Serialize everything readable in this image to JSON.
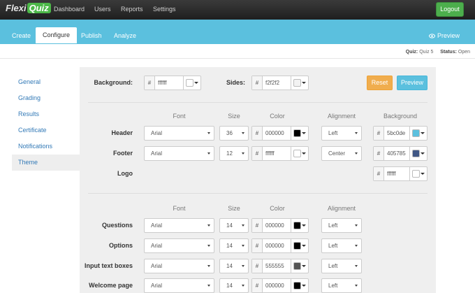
{
  "app": {
    "logo_text": "Flexi",
    "logo_badge": "Quiz"
  },
  "topnav": {
    "items": [
      "Dashboard",
      "Users",
      "Reports",
      "Settings"
    ],
    "logout_label": "Logout"
  },
  "tabs": {
    "items": [
      "Create",
      "Configure",
      "Publish",
      "Analyze"
    ],
    "active": "Configure",
    "preview_label": "Preview"
  },
  "status": {
    "quiz_label": "Quiz:",
    "quiz_value": "Quiz 5",
    "status_label": "Status:",
    "status_value": "Open"
  },
  "sidebar": {
    "items": [
      "General",
      "Grading",
      "Results",
      "Certificate",
      "Notifications",
      "Theme"
    ],
    "active": "Theme"
  },
  "theme": {
    "background_label": "Background:",
    "background_value": "ffffff",
    "background_color": "#ffffff",
    "sides_label": "Sides:",
    "sides_value": "f2f2f2",
    "sides_color": "#f2f2f2",
    "reset_label": "Reset",
    "preview_label": "Preview",
    "hash": "#",
    "section1_headers": {
      "font": "Font",
      "size": "Size",
      "color": "Color",
      "alignment": "Alignment",
      "background": "Background"
    },
    "header": {
      "label": "Header",
      "font": "Arial",
      "size": "36",
      "color_value": "000000",
      "color": "#000000",
      "alignment": "Left",
      "bg_value": "5bc0de",
      "bg_color": "#5bc0de"
    },
    "footer": {
      "label": "Footer",
      "font": "Arial",
      "size": "12",
      "color_value": "ffffff",
      "color": "#ffffff",
      "alignment": "Center",
      "bg_value": "405785",
      "bg_color": "#405785"
    },
    "logo": {
      "label": "Logo",
      "bg_value": "ffffff",
      "bg_color": "#ffffff"
    },
    "section2_headers": {
      "font": "Font",
      "size": "Size",
      "color": "Color",
      "alignment": "Alignment"
    },
    "rows": [
      {
        "label": "Questions",
        "font": "Arial",
        "size": "14",
        "color_value": "000000",
        "color": "#000000",
        "alignment": "Left"
      },
      {
        "label": "Options",
        "font": "Arial",
        "size": "14",
        "color_value": "000000",
        "color": "#000000",
        "alignment": "Left"
      },
      {
        "label": "Input text boxes",
        "font": "Arial",
        "size": "14",
        "color_value": "555555",
        "color": "#555555",
        "alignment": "Left"
      },
      {
        "label": "Welcome page",
        "font": "Arial",
        "size": "14",
        "color_value": "000000",
        "color": "#000000",
        "alignment": "Left"
      }
    ]
  }
}
